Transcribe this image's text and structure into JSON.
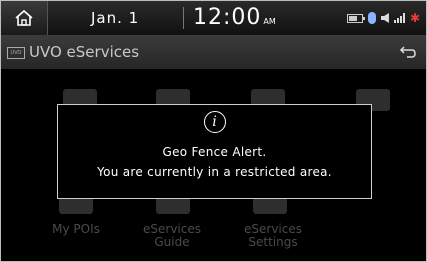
{
  "status_bar": {
    "date": "Jan. 1",
    "time": "12:00",
    "ampm": "AM",
    "icons": [
      "home-icon",
      "battery-icon",
      "bluetooth-icon",
      "volume-icon",
      "signal-icon",
      "recording-icon"
    ]
  },
  "title_bar": {
    "icon_text": "UVO",
    "title": "UVO eServices",
    "back_icon": "back-arrow-icon"
  },
  "grid_items": [
    {
      "label": "My POIs"
    },
    {
      "label": "eServices Guide"
    },
    {
      "label": "eServices Settings"
    }
  ],
  "dialog": {
    "icon": "info-icon",
    "line1": "Geo Fence Alert.",
    "line2": "You are currently in a restricted area."
  },
  "colors": {
    "background": "#000000",
    "accent_red": "#e43b3b",
    "text": "#ffffff",
    "muted_text": "#4a4a4a"
  }
}
